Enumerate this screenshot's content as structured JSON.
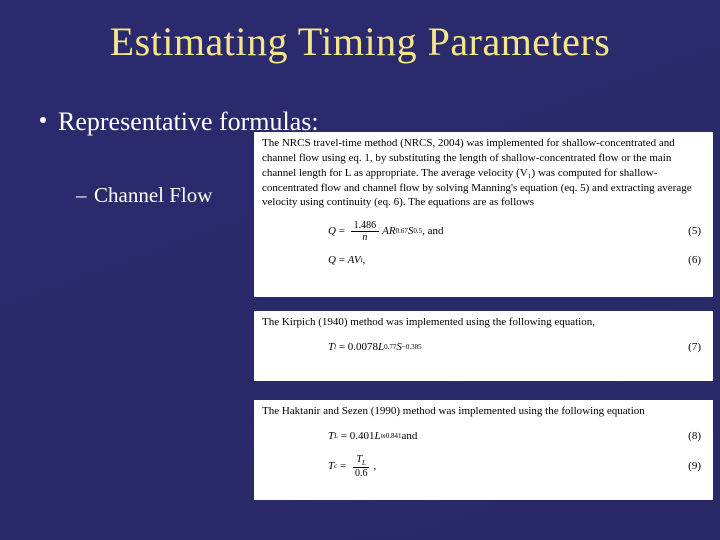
{
  "title": "Estimating Timing Parameters",
  "bullet1": "Representative formulas:",
  "bullet2": "Channel Flow",
  "clip1": {
    "p1": "The NRCS travel-time method (NRCS, 2004) was implemented for shallow-concentrated and channel flow using eq. 1, by substituting the length of shallow-concentrated flow or the main channel length for L as appropriate. The average velocity (V₁) was computed for shallow-concentrated flow and channel flow by solving Manning's equation (eq. 5) and extracting average velocity using continuity (eq. 6). The equations are as follows",
    "eq5": {
      "lhs": "Q",
      "rhs_frac_num": "1.486",
      "rhs_frac_den": "n",
      "rhs_tail": "AR",
      "sup1": "0.67",
      "mid": "S",
      "sup2": "0.5",
      "trail": ", and",
      "num": "(5)"
    },
    "eq6": {
      "lhs": "Q",
      "rhs": "AV",
      "sub": "t",
      "trail": ",",
      "num": "(6)"
    }
  },
  "clip2": {
    "p1": "The Kirpich (1940) method was implemented using the following equation,",
    "eq7": {
      "lhs": "T",
      "lhs_sub": "l",
      "a": "0.0078",
      "L": "L",
      "sup1": "0.77",
      "S": "S",
      "sup2": "−0.385",
      "num": "(7)"
    }
  },
  "clip3": {
    "p1": "The Haktanir and Sezen (1990) method was implemented using the following equation",
    "eq8": {
      "lhs": "T",
      "lhs_sub": "L",
      "a": "0.401",
      "L": "L",
      "L_sub": "m",
      "sup1": "0.841",
      "trail": " and",
      "num": "(8)"
    },
    "eq9": {
      "lhs": "T",
      "lhs_sub": "c",
      "num_t": "T",
      "num_sub": "L",
      "den": "0.6",
      "trail": ",",
      "num": "(9)"
    }
  }
}
